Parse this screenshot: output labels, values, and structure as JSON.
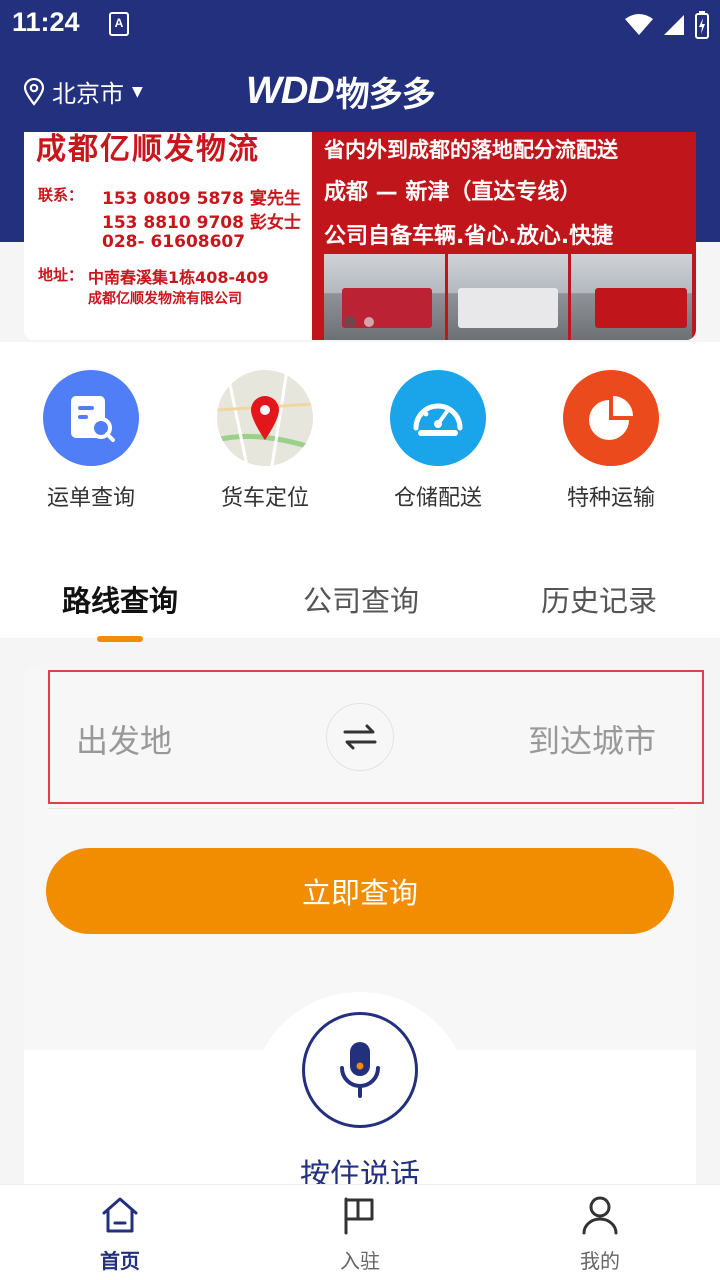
{
  "status_bar": {
    "time": "11:24",
    "notification_icon": "A"
  },
  "header": {
    "city": "北京市",
    "logo_mark": "WDD",
    "logo_text": "物多多"
  },
  "banner": {
    "left_title": "成都亿顺发物流",
    "contact_label": "联系：",
    "contacts": [
      "153 0809 5878  宴先生",
      "153 8810 9708  彭女士",
      "028- 61608607"
    ],
    "address_label": "地址：",
    "address_lines": [
      "中南春溪集1栋408-409",
      "成都亿顺发物流有限公司"
    ],
    "right_lines": [
      "省内外到成都的落地配分流配送",
      "成都 — 新津（直达专线）",
      "公司自备车辆.省心.放心.快捷"
    ]
  },
  "quick_actions": [
    {
      "label": "运单查询",
      "icon": "document-search-icon",
      "color": "#4f7ef7"
    },
    {
      "label": "货车定位",
      "icon": "map-pin-icon",
      "color": "#e8e8e0"
    },
    {
      "label": "仓储配送",
      "icon": "speedometer-icon",
      "color": "#1aa4ea"
    },
    {
      "label": "特种运输",
      "icon": "pie-chart-icon",
      "color": "#ea4a1c"
    }
  ],
  "tabs": [
    {
      "label": "路线查询",
      "active": true
    },
    {
      "label": "公司查询",
      "active": false
    },
    {
      "label": "历史记录",
      "active": false
    }
  ],
  "search": {
    "origin_placeholder": "出发地",
    "destination_placeholder": "到达城市",
    "query_button": "立即查询",
    "voice_label": "按住说话"
  },
  "bottom_nav": [
    {
      "label": "首页",
      "icon": "home-icon",
      "active": true
    },
    {
      "label": "入驻",
      "icon": "flag-icon",
      "active": false
    },
    {
      "label": "我的",
      "icon": "user-icon",
      "active": false
    }
  ],
  "colors": {
    "brand_navy": "#22307d",
    "accent_orange": "#f28c00",
    "highlight_red": "#e53e4a"
  }
}
